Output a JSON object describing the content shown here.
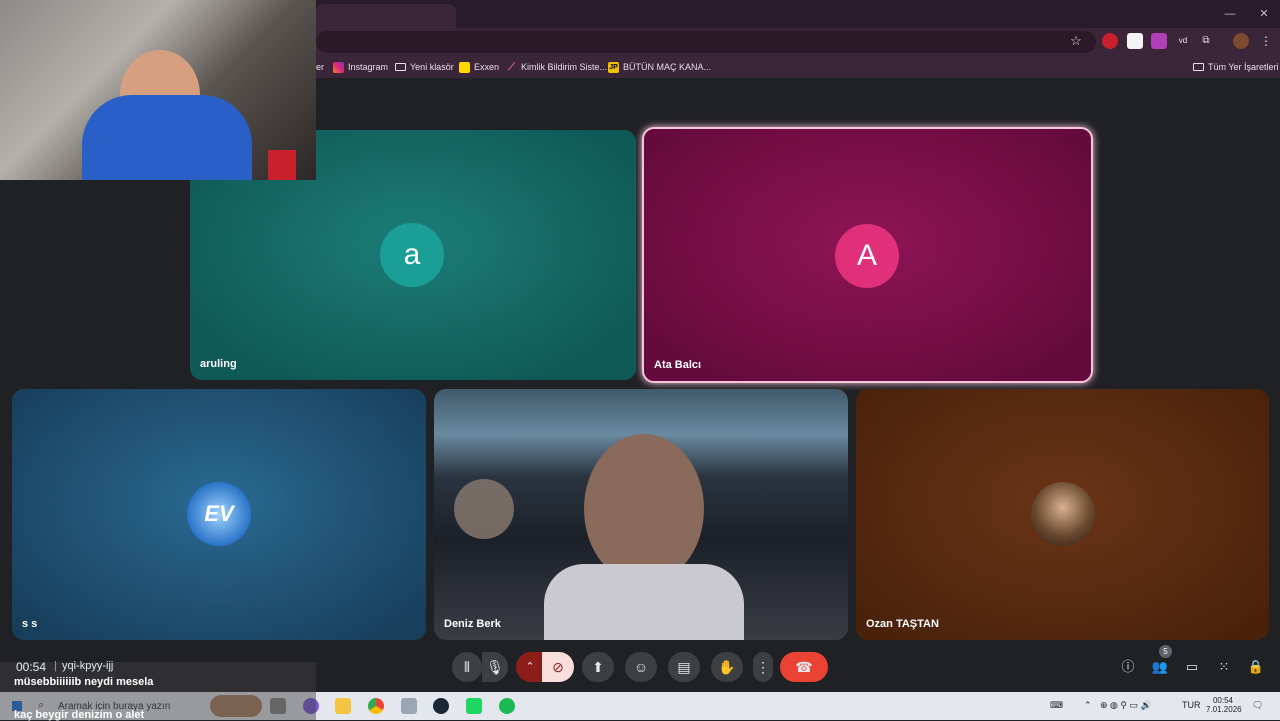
{
  "browser": {
    "bookmarks": [
      {
        "label": "er",
        "icon": "bookmark-partial"
      },
      {
        "label": "Instagram",
        "icon": "instagram-icon"
      },
      {
        "label": "Yeni klasör",
        "icon": "folder-icon"
      },
      {
        "label": "Exxen",
        "icon": "exxen-icon"
      },
      {
        "label": "Kimlik Bildirim Siste...",
        "icon": "link-icon"
      },
      {
        "label": "BÜTÜN MAÇ KANA...",
        "icon": "jp-icon"
      }
    ],
    "all_bookmarks_label": "Tüm Yer İşaretleri"
  },
  "meeting": {
    "participants": [
      {
        "name": "aruling",
        "initial": "a",
        "tile_color": "#136a66",
        "avatar_color": "#1a9a92"
      },
      {
        "name": "Ata Balcı",
        "initial": "A",
        "tile_color": "#7a1048",
        "avatar_color": "#e0307a"
      },
      {
        "name": "s s",
        "initial": "EV",
        "tile_color": "#1c4e70"
      },
      {
        "name": "Deniz Berk"
      },
      {
        "name": "Ozan TAŞTAN",
        "tile_color": "#5a2a10"
      }
    ],
    "time": "00:54",
    "meeting_code": "yqi-kpyy-ijj",
    "people_count": "5"
  },
  "chat_overlay": {
    "line1": "müsebbiiiiiib neydi mesela",
    "line2": "kaç beygir denizim o alet"
  },
  "taskbar": {
    "search_placeholder": "Aramak için buraya yazın",
    "language": "TUR",
    "clock_time": "00:54",
    "clock_date": "7.01.2026"
  },
  "colors": {
    "end_call": "#ea4335",
    "camera_off_bg": "#f9dedc",
    "speaking_border": "#f7c6dc"
  }
}
